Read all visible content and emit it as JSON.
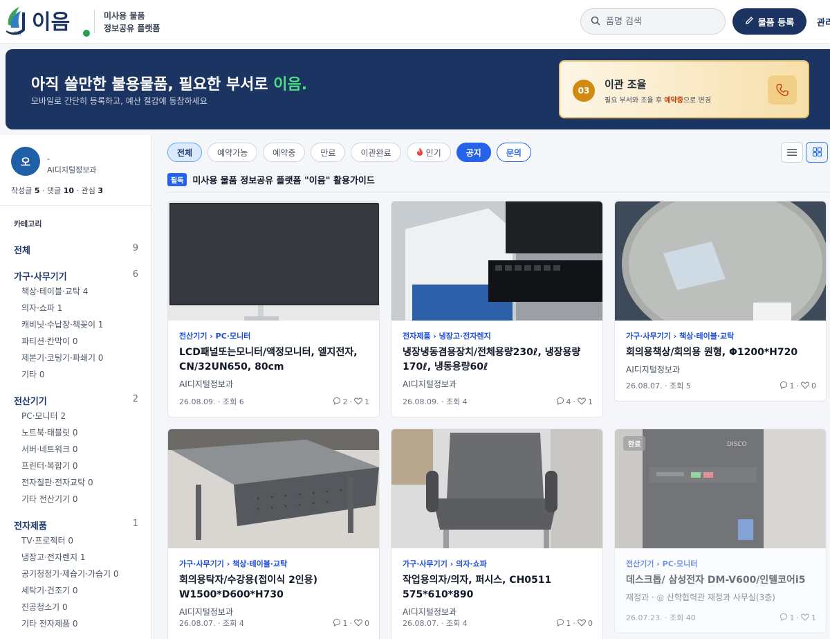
{
  "header": {
    "logo_text": "이음",
    "tagline_line1": "미사용 물품",
    "tagline_line2": "정보공유 플랫폼",
    "search_placeholder": "품명 검색",
    "register_label": "물품 등록",
    "admin_label": "관리"
  },
  "banner": {
    "title_prefix": "아직 쓸만한 불용물품, 필요한 부서로 ",
    "title_accent": "이음.",
    "subtitle": "모바일로 간단히 등록하고, 예산 절감에 동참하세요",
    "step_number": "03",
    "step_title": "이관 조율",
    "step_desc_prefix": "필요 부서와 조율 후 ",
    "step_desc_highlight": "예약중",
    "step_desc_suffix": "으로 변경",
    "colors": {
      "bg": "#1c3461",
      "accent": "#4ade80"
    }
  },
  "user": {
    "avatar_initial": "오",
    "name": "-",
    "dept": "AI디지털정보과",
    "posts_label": "작성글",
    "posts": "5",
    "comments_label": "댓글",
    "comments": "10",
    "interests_label": "관심",
    "interests": "3"
  },
  "categories": {
    "heading": "카테고리",
    "all_label": "전체",
    "all_count": "9",
    "groups": [
      {
        "label": "가구·사무기기",
        "count": "6",
        "subs": [
          "책상·테이블·교탁 4",
          "의자·쇼파 1",
          "캐비닛·수납장·책꽂이 1",
          "파티션·칸막이 0",
          "제본기·코팅기·파쇄기 0",
          "기타 0"
        ]
      },
      {
        "label": "전산기기",
        "count": "2",
        "subs": [
          "PC·모니터 2",
          "노트북·태블릿 0",
          "서버·네트워크 0",
          "프린터·복합기 0",
          "전자칠판·전자교탁 0",
          "기타 전산기기 0"
        ]
      },
      {
        "label": "전자제품",
        "count": "1",
        "subs": [
          "TV·프로젝터 0",
          "냉장고·전자렌지 1",
          "공기청정기·제습기·가습기 0",
          "세탁기·건조기 0",
          "진공청소기 0",
          "기타 전자제품 0"
        ]
      }
    ]
  },
  "filters": [
    "전체",
    "예약가능",
    "예약중",
    "만료",
    "이관완료",
    "인기",
    "공지",
    "문의"
  ],
  "notice": {
    "pin_label": "필독",
    "title": "미사용 물품 정보공유 플랫폼 \"이음\" 활용가이드"
  },
  "cards": [
    {
      "category": "전산기기 › PC·모니터",
      "title": "LCD패널또는모니터/액정모니터, 엘지전자, CN/32UN650, 80cm",
      "dept": "AI디지털정보과",
      "meta": "26.08.09. · 조회 6",
      "comments": "2",
      "likes": "1"
    },
    {
      "category": "전자제품 › 냉장고·전자렌지",
      "title": "냉장냉동겸용장치/전체용량230ℓ, 냉장용량 170ℓ, 냉동용량60ℓ",
      "dept": "AI디지털정보과",
      "meta": "26.08.09. · 조회 4",
      "comments": "4",
      "likes": "1"
    },
    {
      "category": "가구·사무기기 › 책상·테이블·교탁",
      "title": "회의용책상/회의용 원형, Φ1200*H720",
      "dept": "AI디지털정보과",
      "meta": "26.08.07. · 조회 5",
      "comments": "1",
      "likes": "0"
    },
    {
      "category": "가구·사무기기 › 책상·테이블·교탁",
      "title": "회의용탁자/수강용(접이식 2인용) W1500*D600*H730",
      "dept": "AI디지털정보과",
      "meta": "26.08.07. · 조회 4",
      "comments": "1",
      "likes": "0"
    },
    {
      "category": "가구·사무기기 › 의자·쇼파",
      "title": "작업용의자/의자, 퍼시스, CH0511 575*610*890",
      "dept": "AI디지털정보과",
      "meta": "26.08.07. · 조회 4",
      "comments": "1",
      "likes": "0"
    },
    {
      "category": "전산기기 › PC·모니터",
      "title": "데스크톱/ 삼성전자 DM-V600/인텔코어i5",
      "dept": "재정과 · ◎ 산학협력관 재정과 사무실(3층)",
      "meta": "26.07.23. · 조회 40",
      "comments": "1",
      "likes": "1",
      "badge": "완료",
      "monitor_brand": "DISCO"
    }
  ]
}
